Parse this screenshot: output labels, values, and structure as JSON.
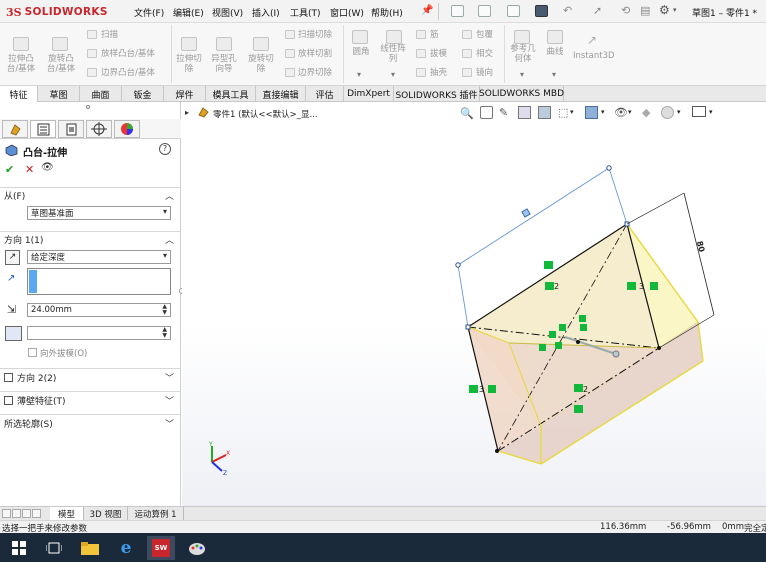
{
  "app": {
    "logo_ds": "3S",
    "logo_text": "SOLIDWORKS",
    "window_title": "草图1 – 零件1 *"
  },
  "menu": [
    "文件(F)",
    "编辑(E)",
    "视图(V)",
    "插入(I)",
    "工具(T)",
    "窗口(W)",
    "帮助(H)"
  ],
  "commands": {
    "extrude_boss": "拉伸凸\n台/基体",
    "revolve_boss": "旋转凸\n台/基体",
    "sweep": "扫描",
    "loft": "放样凸台/基体",
    "boundary": "边界凸台/基体",
    "extrude_cut": "拉伸切\n除",
    "hole_wizard": "异型孔\n向导",
    "revolve_cut": "旋转切\n除",
    "sweep_cut": "扫描切除",
    "loft_cut": "放样切割",
    "boundary_cut": "边界切除",
    "fillet": "圆角",
    "linear_pattern": "线性阵\n列",
    "rib": "筋",
    "draft": "拔模",
    "shell": "抽壳",
    "wrap": "包覆",
    "intersect": "相交",
    "mirror": "镜向",
    "ref_geometry": "参考几\n何体",
    "curves": "曲线",
    "instant3d": "Instant3D"
  },
  "tabs": [
    "特征",
    "草图",
    "曲面",
    "钣金",
    "焊件",
    "模具工具",
    "直接编辑",
    "评估",
    "DimXpert",
    "SOLIDWORKS 插件",
    "SOLIDWORKS MBD"
  ],
  "feature_panel": {
    "title": "凸台-拉伸",
    "help_icon": "?",
    "ok": "✔",
    "cancel": "✕",
    "preview": "👁",
    "from_label": "从(F)",
    "from_value": "草图基准面",
    "dir1_label": "方向 1(1)",
    "end_condition": "给定深度",
    "depth_value": "24.00mm",
    "draft_outward": "向外拔模(O)",
    "dir2_label": "方向 2(2)",
    "thin_feature": "薄壁特征(T)",
    "selected_contours": "所选轮廓(S)"
  },
  "tree": {
    "item": "零件1  (默认<<默认>_显...",
    "expand": "▸"
  },
  "bottom_tabs": [
    "模型",
    "3D 视图",
    "运动算例 1"
  ],
  "status": {
    "message": "选择一把手来修改参数",
    "x": "116.36mm",
    "y": "-56.96mm",
    "z": "0mm",
    "state": "完全定"
  },
  "sketch": {
    "dim_value": "80",
    "relation_label": "2",
    "relation_label2": "3"
  },
  "colors": {
    "accent": "#c8262c",
    "selection": "#ffffe0",
    "extrude_face": "#eadfd8",
    "relation_green": "#12b83a"
  }
}
